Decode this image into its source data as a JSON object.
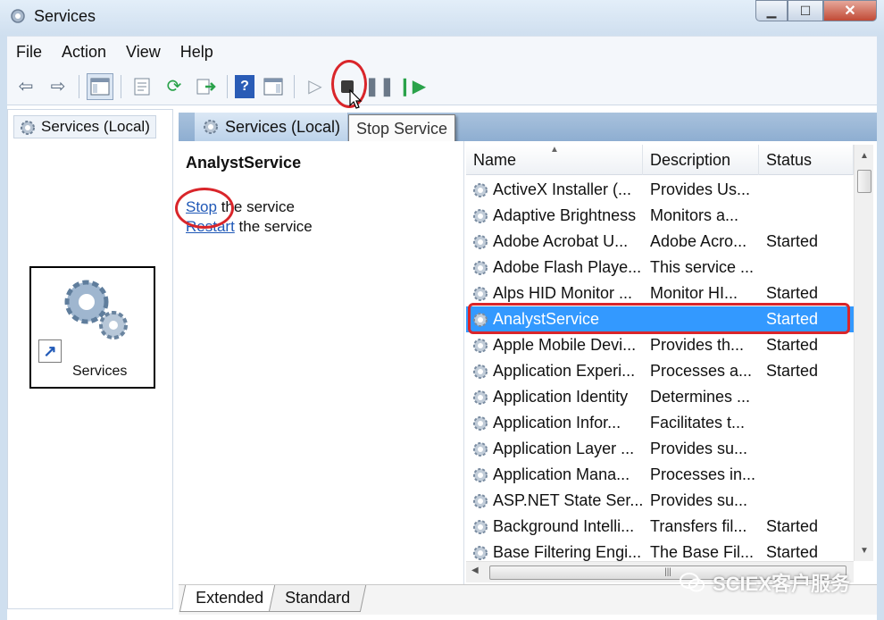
{
  "window": {
    "title": "Services",
    "minimize": "▁",
    "maximize": "☐",
    "close": "✕"
  },
  "menu": [
    "File",
    "Action",
    "View",
    "Help"
  ],
  "toolbar": {
    "tooltip": "Stop Service",
    "highlighted_button": "stop-service-button"
  },
  "tree": {
    "root_label": "Services (Local)"
  },
  "header": {
    "label": "Services (Local)"
  },
  "extended": {
    "service_name": "AnalystService",
    "stop_link": "Stop",
    "stop_rest": " the service",
    "restart_link": "Restart",
    "restart_rest": " the service"
  },
  "list": {
    "columns": [
      "Name",
      "Description",
      "Status"
    ],
    "rows": [
      {
        "name": "ActiveX Installer (...",
        "description": "Provides Us...",
        "status": ""
      },
      {
        "name": "Adaptive Brightness",
        "description": "Monitors a...",
        "status": ""
      },
      {
        "name": "Adobe Acrobat U...",
        "description": "Adobe Acro...",
        "status": "Started"
      },
      {
        "name": "Adobe Flash Playe...",
        "description": "This service ...",
        "status": ""
      },
      {
        "name": "Alps HID Monitor ...",
        "description": "Monitor HI...",
        "status": "Started"
      },
      {
        "name": "AnalystService",
        "description": "",
        "status": "Started",
        "selected": true
      },
      {
        "name": "Apple Mobile Devi...",
        "description": "Provides th...",
        "status": "Started"
      },
      {
        "name": "Application Experi...",
        "description": "Processes a...",
        "status": "Started"
      },
      {
        "name": "Application Identity",
        "description": "Determines ...",
        "status": ""
      },
      {
        "name": "Application Infor...",
        "description": "Facilitates t...",
        "status": ""
      },
      {
        "name": "Application Layer ...",
        "description": "Provides su...",
        "status": ""
      },
      {
        "name": "Application Mana...",
        "description": "Processes in...",
        "status": ""
      },
      {
        "name": "ASP.NET State Ser...",
        "description": "Provides su...",
        "status": ""
      },
      {
        "name": "Background Intelli...",
        "description": "Transfers fil...",
        "status": "Started"
      },
      {
        "name": "Base Filtering Engi...",
        "description": "The Base Fil...",
        "status": "Started"
      }
    ]
  },
  "tabs": [
    "Extended",
    "Standard"
  ],
  "shortcut": {
    "label": "Services"
  },
  "watermark": "SCIEX客户服务",
  "colors": {
    "selection": "#3399ff",
    "highlight_ring": "#d9252a",
    "link": "#1f58b7"
  },
  "icons": [
    "back-arrow-icon",
    "forward-arrow-icon",
    "console-tree-icon",
    "properties-icon",
    "refresh-icon",
    "export-list-icon",
    "help-icon",
    "show-action-pane-icon",
    "start-service-icon",
    "stop-service-icon",
    "pause-service-icon",
    "resume-service-icon",
    "gear-icon"
  ]
}
